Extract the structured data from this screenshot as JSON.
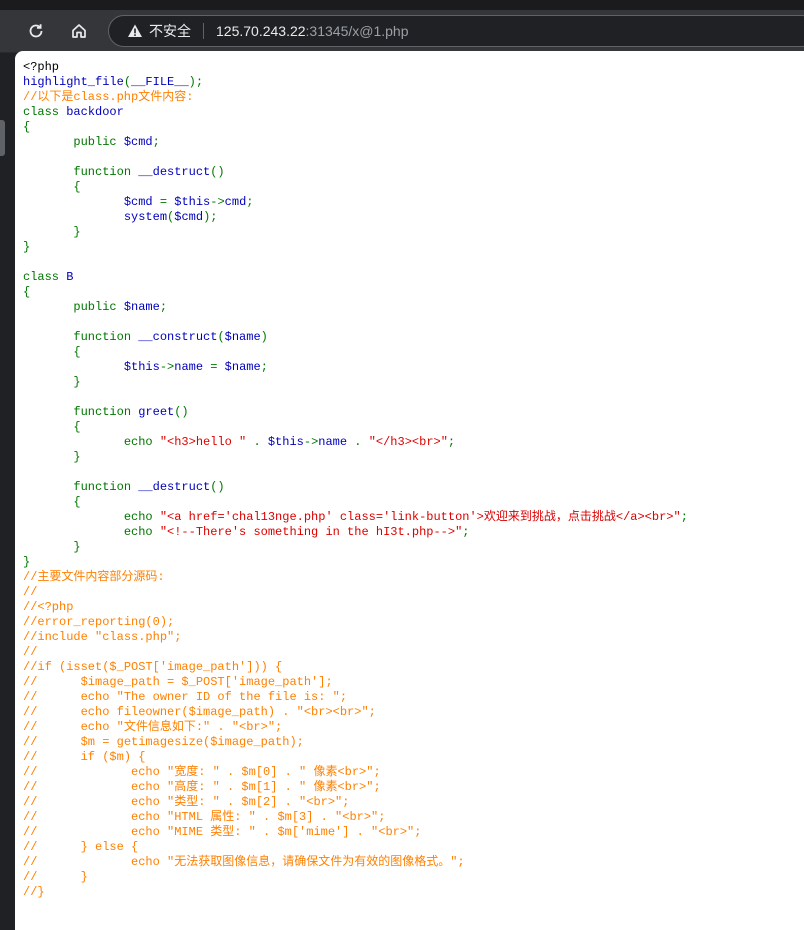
{
  "browser": {
    "security_label": "不安全",
    "url_host": "125.70.243.22",
    "url_rest": ":31345/x@1.php",
    "icons": [
      "reload-icon",
      "home-icon",
      "warning-icon"
    ]
  },
  "code_colors": {
    "html": "#000000",
    "default": "#0000BB",
    "keyword": "#007700",
    "comment": "#FF8000",
    "string": "#DD0000"
  },
  "code_lines": [
    [
      [
        "html",
        "<?php"
      ]
    ],
    [
      [
        "default",
        "highlight_file"
      ],
      [
        "keyword",
        "("
      ],
      [
        "default",
        "__FILE__"
      ],
      [
        "keyword",
        ");"
      ]
    ],
    [
      [
        "comment",
        "//以下是class.php文件内容:"
      ]
    ],
    [
      [
        "keyword",
        "class "
      ],
      [
        "default",
        "backdoor"
      ]
    ],
    [
      [
        "keyword",
        "{"
      ]
    ],
    [
      [
        "keyword",
        "       public "
      ],
      [
        "default",
        "$cmd"
      ],
      [
        "keyword",
        ";"
      ]
    ],
    [],
    [
      [
        "keyword",
        "       function "
      ],
      [
        "default",
        "__destruct"
      ],
      [
        "keyword",
        "()"
      ]
    ],
    [
      [
        "keyword",
        "       {"
      ]
    ],
    [
      [
        "keyword",
        "              "
      ],
      [
        "default",
        "$cmd "
      ],
      [
        "keyword",
        "= "
      ],
      [
        "default",
        "$this"
      ],
      [
        "keyword",
        "->"
      ],
      [
        "default",
        "cmd"
      ],
      [
        "keyword",
        ";"
      ]
    ],
    [
      [
        "keyword",
        "              "
      ],
      [
        "default",
        "system"
      ],
      [
        "keyword",
        "("
      ],
      [
        "default",
        "$cmd"
      ],
      [
        "keyword",
        ");"
      ]
    ],
    [
      [
        "keyword",
        "       }"
      ]
    ],
    [
      [
        "keyword",
        "}"
      ]
    ],
    [],
    [
      [
        "keyword",
        "class "
      ],
      [
        "default",
        "B"
      ]
    ],
    [
      [
        "keyword",
        "{"
      ]
    ],
    [
      [
        "keyword",
        "       public "
      ],
      [
        "default",
        "$name"
      ],
      [
        "keyword",
        ";"
      ]
    ],
    [],
    [
      [
        "keyword",
        "       function "
      ],
      [
        "default",
        "__construct"
      ],
      [
        "keyword",
        "("
      ],
      [
        "default",
        "$name"
      ],
      [
        "keyword",
        ")"
      ]
    ],
    [
      [
        "keyword",
        "       {"
      ]
    ],
    [
      [
        "keyword",
        "              "
      ],
      [
        "default",
        "$this"
      ],
      [
        "keyword",
        "->"
      ],
      [
        "default",
        "name "
      ],
      [
        "keyword",
        "= "
      ],
      [
        "default",
        "$name"
      ],
      [
        "keyword",
        ";"
      ]
    ],
    [
      [
        "keyword",
        "       }"
      ]
    ],
    [],
    [
      [
        "keyword",
        "       function "
      ],
      [
        "default",
        "greet"
      ],
      [
        "keyword",
        "()"
      ]
    ],
    [
      [
        "keyword",
        "       {"
      ]
    ],
    [
      [
        "keyword",
        "              echo "
      ],
      [
        "string",
        "\"<h3>hello \" "
      ],
      [
        "keyword",
        ". "
      ],
      [
        "default",
        "$this"
      ],
      [
        "keyword",
        "->"
      ],
      [
        "default",
        "name "
      ],
      [
        "keyword",
        ". "
      ],
      [
        "string",
        "\"</h3><br>\""
      ],
      [
        "keyword",
        ";"
      ]
    ],
    [
      [
        "keyword",
        "       }"
      ]
    ],
    [],
    [
      [
        "keyword",
        "       function "
      ],
      [
        "default",
        "__destruct"
      ],
      [
        "keyword",
        "()"
      ]
    ],
    [
      [
        "keyword",
        "       {"
      ]
    ],
    [
      [
        "keyword",
        "              echo "
      ],
      [
        "string",
        "\"<a href='chal13nge.php' class='link-button'>欢迎来到挑战，点击挑战</a><br>\""
      ],
      [
        "keyword",
        ";"
      ]
    ],
    [
      [
        "keyword",
        "              echo "
      ],
      [
        "string",
        "\"<!--There's something in the hI3t.php-->\""
      ],
      [
        "keyword",
        ";"
      ]
    ],
    [
      [
        "keyword",
        "       }"
      ]
    ],
    [
      [
        "keyword",
        "}"
      ]
    ],
    [
      [
        "comment",
        "//主要文件内容部分源码:"
      ]
    ],
    [
      [
        "comment",
        "//"
      ]
    ],
    [
      [
        "comment",
        "//<?php"
      ]
    ],
    [
      [
        "comment",
        "//error_reporting(0);"
      ]
    ],
    [
      [
        "comment",
        "//include \"class.php\";"
      ]
    ],
    [
      [
        "comment",
        "//"
      ]
    ],
    [
      [
        "comment",
        "//if (isset($_POST['image_path'])) {"
      ]
    ],
    [
      [
        "comment",
        "//      $image_path = $_POST['image_path'];"
      ]
    ],
    [
      [
        "comment",
        "//      echo \"The owner ID of the file is: \";"
      ]
    ],
    [
      [
        "comment",
        "//      echo fileowner($image_path) . \"<br><br>\";"
      ]
    ],
    [
      [
        "comment",
        "//      echo \"文件信息如下:\" . \"<br>\";"
      ]
    ],
    [
      [
        "comment",
        "//      $m = getimagesize($image_path);"
      ]
    ],
    [
      [
        "comment",
        "//      if ($m) {"
      ]
    ],
    [
      [
        "comment",
        "//             echo \"宽度: \" . $m[0] . \" 像素<br>\";"
      ]
    ],
    [
      [
        "comment",
        "//             echo \"高度: \" . $m[1] . \" 像素<br>\";"
      ]
    ],
    [
      [
        "comment",
        "//             echo \"类型: \" . $m[2] . \"<br>\";"
      ]
    ],
    [
      [
        "comment",
        "//             echo \"HTML 属性: \" . $m[3] . \"<br>\";"
      ]
    ],
    [
      [
        "comment",
        "//             echo \"MIME 类型: \" . $m['mime'] . \"<br>\";"
      ]
    ],
    [
      [
        "comment",
        "//      } else {"
      ]
    ],
    [
      [
        "comment",
        "//             echo \"无法获取图像信息，请确保文件为有效的图像格式。\";"
      ]
    ],
    [
      [
        "comment",
        "//      }"
      ]
    ],
    [
      [
        "comment",
        "//}"
      ]
    ]
  ]
}
